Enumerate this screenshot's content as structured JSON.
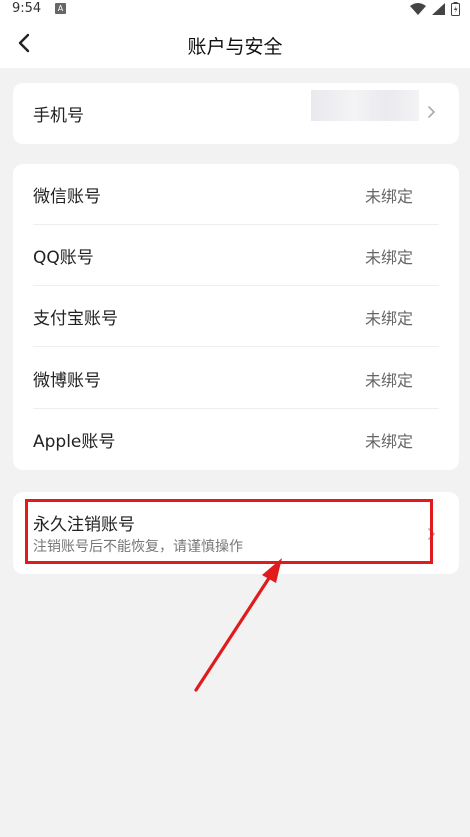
{
  "status_bar": {
    "time": "9:54",
    "app_icon_letter": "A"
  },
  "header": {
    "title": "账户与安全"
  },
  "phone": {
    "label": "手机号"
  },
  "bindings": [
    {
      "label": "微信账号",
      "status": "未绑定"
    },
    {
      "label": "QQ账号",
      "status": "未绑定"
    },
    {
      "label": "支付宝账号",
      "status": "未绑定"
    },
    {
      "label": "微博账号",
      "status": "未绑定"
    },
    {
      "label": "Apple账号",
      "status": "未绑定"
    }
  ],
  "deactivate": {
    "title": "永久注销账号",
    "subtitle": "注销账号后不能恢复，请谨慎操作"
  },
  "colors": {
    "background": "#f2f2f2",
    "card": "#ffffff",
    "annotation_red": "#e01b1b",
    "secondary_text": "#666666"
  },
  "icons": [
    "back-arrow-icon",
    "chevron-right-icon",
    "wifi-icon",
    "signal-icon",
    "battery-icon"
  ]
}
